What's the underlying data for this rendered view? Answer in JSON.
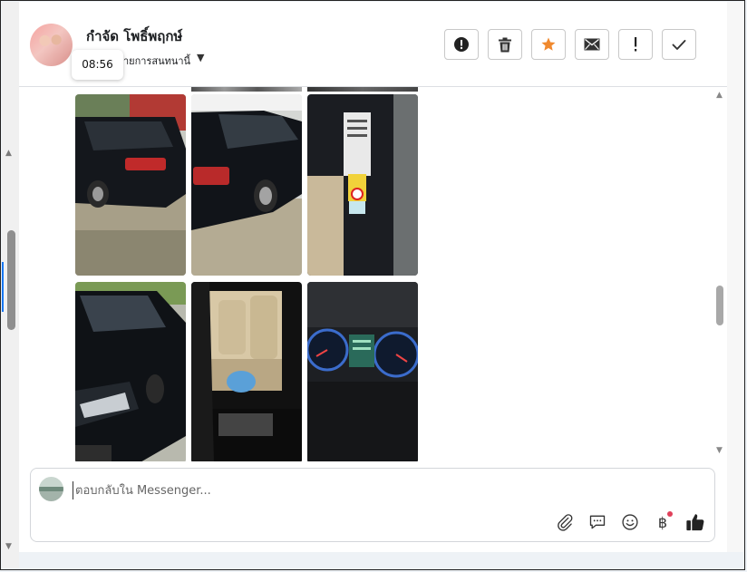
{
  "header": {
    "contact_name": "กำจัด โพธิ์พฤกษ์",
    "subtitle": "ายการสนทนานี้",
    "tooltip_time": "08:56"
  },
  "toolbar": {
    "buttons": [
      {
        "name": "report-button",
        "icon": "exclamation-circle-icon"
      },
      {
        "name": "delete-button",
        "icon": "trash-icon"
      },
      {
        "name": "star-button",
        "icon": "star-icon",
        "color": "#f0892e"
      },
      {
        "name": "mark-unread-button",
        "icon": "envelope-icon"
      },
      {
        "name": "follow-up-button",
        "icon": "exclamation-icon"
      },
      {
        "name": "mark-done-button",
        "icon": "checkmark-icon"
      }
    ]
  },
  "messages": {
    "photos": [
      {
        "name": "car-photo-rear-left",
        "subject": "black sedan rear"
      },
      {
        "name": "car-photo-rear-side",
        "subject": "black sedan side"
      },
      {
        "name": "car-photo-door-sticker",
        "subject": "door pillar sticker"
      },
      {
        "name": "car-photo-front",
        "subject": "black sedan front"
      },
      {
        "name": "car-photo-interior",
        "subject": "rear seats interior"
      },
      {
        "name": "car-photo-dashboard",
        "subject": "instrument cluster"
      }
    ]
  },
  "composer": {
    "placeholder": "ตอบกลับใน Messenger...",
    "icons": [
      "attachment-icon",
      "saved-reply-icon",
      "emoji-icon",
      "baht-payment-icon",
      "thumbs-up-icon"
    ],
    "baht_symbol": "฿"
  },
  "colors": {
    "accent": "#1877f2",
    "star": "#f0892e",
    "notify_dot": "#e0405a"
  }
}
